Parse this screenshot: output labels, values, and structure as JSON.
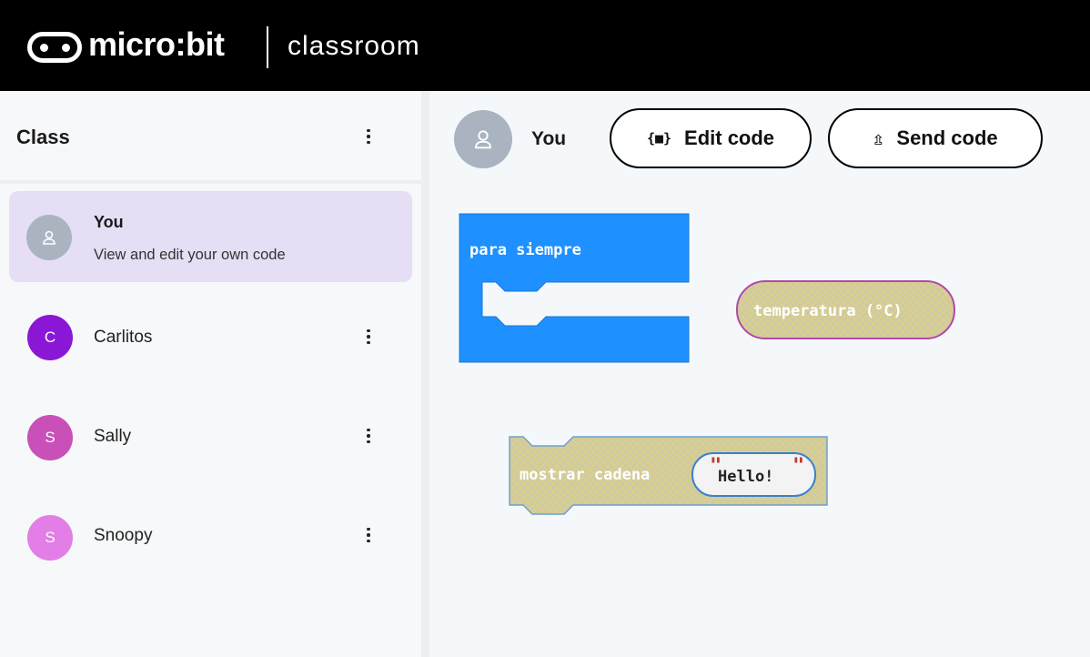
{
  "header": {
    "brand": "micro:bit",
    "product": "classroom"
  },
  "sidebar": {
    "title": "Class",
    "you_item": {
      "name": "You",
      "subtitle": "View and edit your own code"
    },
    "students": [
      {
        "initial": "C",
        "name": "Carlitos",
        "color": "#8a17d6"
      },
      {
        "initial": "S",
        "name": "Sally",
        "color": "#c850b8"
      },
      {
        "initial": "S",
        "name": "Snoopy",
        "color": "#e27ee6"
      }
    ]
  },
  "toolbar": {
    "user_label": "You",
    "edit_code_label": "Edit code",
    "edit_code_icon": "{■}",
    "send_code_label": "Send code",
    "send_code_icon": "⇫"
  },
  "workspace": {
    "forever_block": "para siempre",
    "temperature_block": "temperatura (°C)",
    "show_string_block": "mostrar cadena",
    "string_value": "Hello!"
  },
  "colors": {
    "header_bg": "#000000",
    "selected_item_bg": "#e6def4",
    "basic_block": "#1e90ff",
    "disabled_block": "#d8d08a"
  }
}
